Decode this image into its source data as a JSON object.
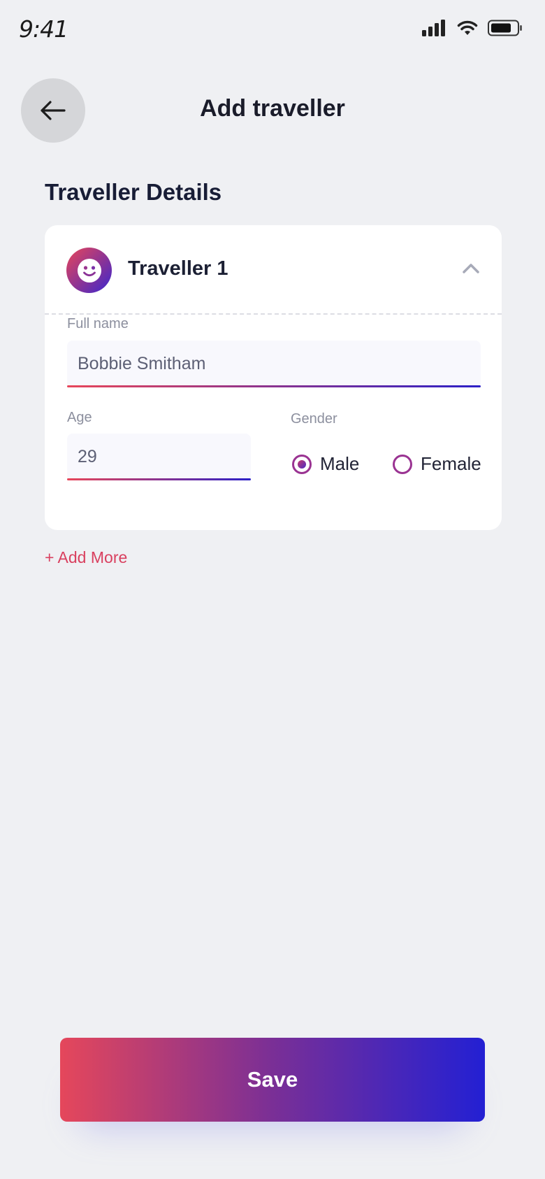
{
  "status_bar": {
    "time": "9:41",
    "icons": [
      "signal-icon",
      "wifi-icon",
      "battery-icon"
    ]
  },
  "header": {
    "back_icon": "arrow-left-icon",
    "title": "Add traveller"
  },
  "section": {
    "title": "Traveller Details"
  },
  "traveller_card": {
    "avatar_icon": "smiley-icon",
    "name": "Traveller 1",
    "collapse_icon": "chevron-up-icon",
    "full_name": {
      "label": "Full name",
      "value": "Bobbie Smitham"
    },
    "age": {
      "label": "Age",
      "value": "29"
    },
    "gender": {
      "label": "Gender",
      "options": [
        {
          "label": "Male",
          "selected": true
        },
        {
          "label": "Female",
          "selected": false
        }
      ]
    }
  },
  "actions": {
    "add_more": "+ Add More",
    "save": "Save"
  },
  "colors": {
    "background": "#eff0f3",
    "accent_start": "#e5475b",
    "accent_end": "#2320d3",
    "link": "#d9405f"
  }
}
